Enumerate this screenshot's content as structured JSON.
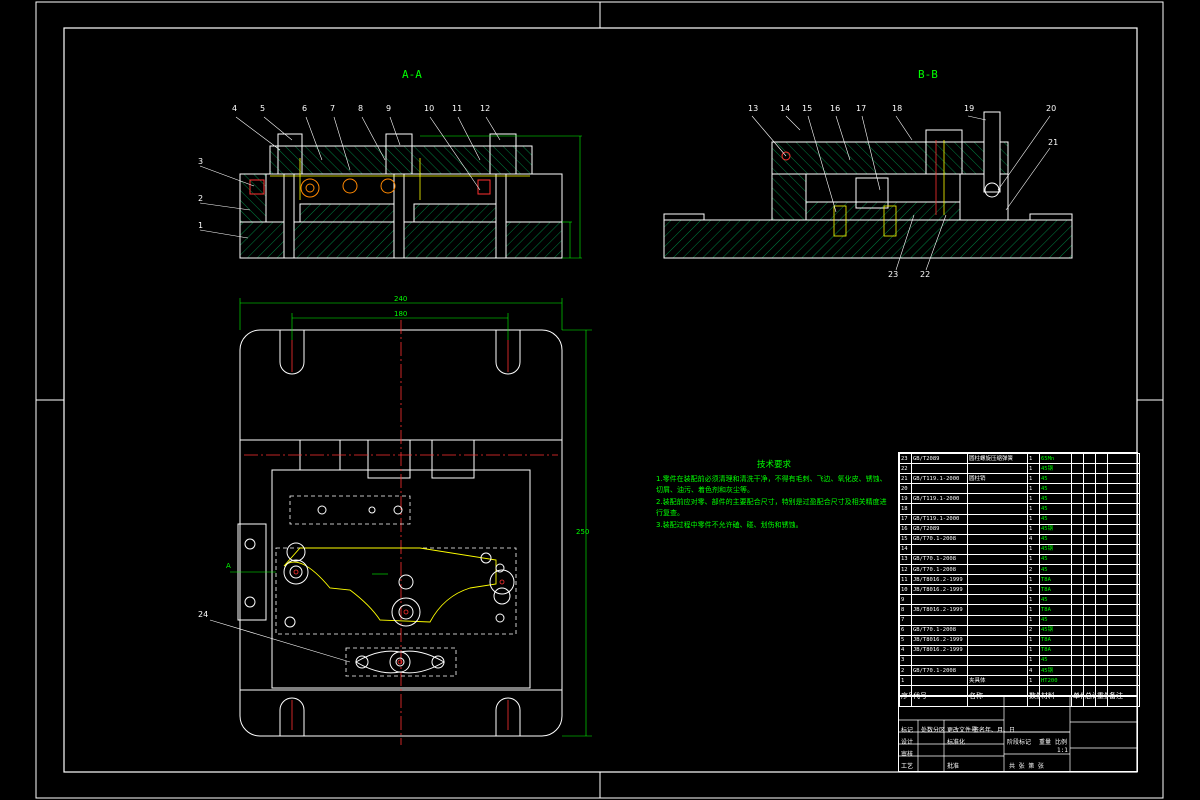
{
  "views": {
    "section_a": "A-A",
    "section_b": "B-B"
  },
  "technical_requirements": {
    "title": "技术要求",
    "items": [
      "1.零件在装配前必须清理和清洗干净，不得有毛刺、飞边、氧化皮、锈蚀、切屑、油污、着色剂和灰尘等。",
      "2.装配前应对零、部件的主要配合尺寸，特别是过盈配合尺寸及相关精度进行复查。",
      "3.装配过程中零件不允许磕、碰、划伤和锈蚀。"
    ]
  },
  "bom": {
    "rows": [
      {
        "no": "23",
        "code": "GB/T2089",
        "name": "圆柱螺旋压缩弹簧",
        "qty": "1",
        "mat": "65Mn"
      },
      {
        "no": "22",
        "code": "",
        "name": "",
        "qty": "1",
        "mat": "45钢"
      },
      {
        "no": "21",
        "code": "GB/T119.1-2000",
        "name": "圆柱销",
        "qty": "1",
        "mat": "45"
      },
      {
        "no": "20",
        "code": "",
        "name": "",
        "qty": "1",
        "mat": "45"
      },
      {
        "no": "19",
        "code": "GB/T119.1-2000",
        "name": "",
        "qty": "1",
        "mat": "45"
      },
      {
        "no": "18",
        "code": "",
        "name": "",
        "qty": "1",
        "mat": "45"
      },
      {
        "no": "17",
        "code": "GB/T119.1-2000",
        "name": "",
        "qty": "1",
        "mat": "45"
      },
      {
        "no": "16",
        "code": "GB/T2089",
        "name": "",
        "qty": "1",
        "mat": "45钢"
      },
      {
        "no": "15",
        "code": "GB/T70.1-2008",
        "name": "",
        "qty": "4",
        "mat": "45"
      },
      {
        "no": "14",
        "code": "",
        "name": "",
        "qty": "1",
        "mat": "45钢"
      },
      {
        "no": "13",
        "code": "GB/T70.1-2008",
        "name": "",
        "qty": "1",
        "mat": "45"
      },
      {
        "no": "12",
        "code": "GB/T70.1-2008",
        "name": "",
        "qty": "2",
        "mat": "45"
      },
      {
        "no": "11",
        "code": "JB/T8016.2-1999",
        "name": "",
        "qty": "1",
        "mat": "T8A"
      },
      {
        "no": "10",
        "code": "JB/T8016.2-1999",
        "name": "",
        "qty": "1",
        "mat": "T8A"
      },
      {
        "no": "9",
        "code": "",
        "name": "",
        "qty": "1",
        "mat": "45"
      },
      {
        "no": "8",
        "code": "JB/T8016.2-1999",
        "name": "",
        "qty": "1",
        "mat": "T8A"
      },
      {
        "no": "7",
        "code": "",
        "name": "",
        "qty": "1",
        "mat": "45"
      },
      {
        "no": "6",
        "code": "GB/T70.1-2008",
        "name": "",
        "qty": "2",
        "mat": "45钢"
      },
      {
        "no": "5",
        "code": "JB/T8016.2-1999",
        "name": "",
        "qty": "1",
        "mat": "T8A"
      },
      {
        "no": "4",
        "code": "JB/T8016.2-1999",
        "name": "",
        "qty": "1",
        "mat": "T8A"
      },
      {
        "no": "3",
        "code": "",
        "name": "",
        "qty": "1",
        "mat": "45"
      },
      {
        "no": "2",
        "code": "GB/T70.1-2008",
        "name": "",
        "qty": "4",
        "mat": "45钢"
      },
      {
        "no": "1",
        "code": "",
        "name": "夹具体",
        "qty": "1",
        "mat": "HT200"
      }
    ],
    "header": {
      "no": "序号",
      "code": "代号",
      "name": "名称",
      "qty": "数量",
      "mat": "材料",
      "unit": "单件",
      "total": "总计",
      "weight": "重量",
      "remark": "备注"
    }
  },
  "title_block": {
    "mark": "标记",
    "count": "处数",
    "zone": "分区",
    "change": "更改文件号",
    "sign": "签名",
    "date": "年、月、日",
    "design": "设计",
    "standard": "标准化",
    "review": "审核",
    "process": "工艺",
    "approve": "批准",
    "stage": "阶段标记",
    "weight": "重量",
    "scale": "比例",
    "scale_val": "1:1",
    "sheets": "共 张 第 张"
  },
  "dimensions": {
    "width_outer": "240",
    "width_inner": "180",
    "height_right": "250",
    "label_a": "A",
    "leader_24": "24"
  },
  "section_a_balloons": [
    "4",
    "5",
    "6",
    "7",
    "8",
    "9",
    "10",
    "11",
    "12"
  ],
  "section_a_left_balloons": [
    "3",
    "2",
    "1"
  ],
  "section_b_balloons": [
    "13",
    "14",
    "15",
    "16",
    "17",
    "18",
    "19",
    "20",
    "21"
  ],
  "section_b_bottom_balloons": [
    "23",
    "22"
  ]
}
